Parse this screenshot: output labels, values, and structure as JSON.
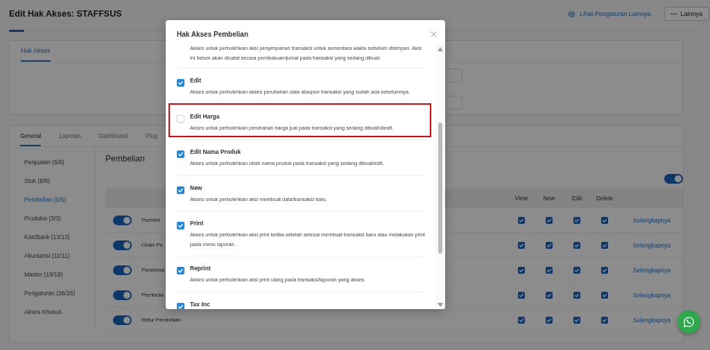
{
  "page": {
    "title": "Edit Hak Akses: STAFFSUS",
    "settings_link": "Lihat Pengaturan Lainnya",
    "more_button": "Lainnya"
  },
  "top_card": {
    "tabs": [
      {
        "label": "Hak Akses",
        "selected": true
      }
    ]
  },
  "section": {
    "tabs": [
      {
        "label": "General",
        "selected": true
      },
      {
        "label": "Laporan",
        "selected": false
      },
      {
        "label": "Dashboard",
        "selected": false
      },
      {
        "label": "Plug",
        "selected": false
      }
    ],
    "sidebar": [
      {
        "label": "Penjualan (6/6)",
        "selected": false
      },
      {
        "label": "Stok (8/8)",
        "selected": false
      },
      {
        "label": "Pembelian (5/5)",
        "selected": true
      },
      {
        "label": "Produksi (3/3)",
        "selected": false
      },
      {
        "label": "Kas/Bank (13/13)",
        "selected": false
      },
      {
        "label": "Akuntansi (11/11)",
        "selected": false
      },
      {
        "label": "Master (18/18)",
        "selected": false
      },
      {
        "label": "Pengaturan (26/26)",
        "selected": false
      },
      {
        "label": "Akses Khusus",
        "selected": false
      }
    ],
    "heading": "Pembelian",
    "all_on": true,
    "columns": [
      "View",
      "New",
      "Edit",
      "Delete"
    ],
    "rows": [
      {
        "name": "Permint",
        "on": true,
        "checks": [
          true,
          true,
          true,
          true
        ],
        "link": "Selengkapnya"
      },
      {
        "name": "Order Pe",
        "on": true,
        "checks": [
          true,
          true,
          true,
          true
        ],
        "link": "Selengkapnya"
      },
      {
        "name": "Penerima",
        "on": true,
        "checks": [
          true,
          true,
          true,
          true
        ],
        "link": "Selengkapnya"
      },
      {
        "name": "Pembelia",
        "on": true,
        "checks": [
          true,
          true,
          true,
          true
        ],
        "link": "Selengkapnya"
      },
      {
        "name": "Retur Pembelian",
        "on": true,
        "checks": [
          true,
          true,
          true,
          true
        ],
        "link": "Selengkapnya"
      }
    ]
  },
  "modal": {
    "title": "Hak Akses Pembelian",
    "cut_description": "Akses untuk perbolehkan aksi penyimpanan transaksi untuk sementara waktu sebelum disimpan. Aksi ini belum akan dicatat secara pembukuan/jurnal pada transaksi yang sedang dibuat.",
    "items": [
      {
        "label": "Edit",
        "checked": true,
        "highlighted": false,
        "description": "Akses untuk perbolehkan akses perubahan data ataupun transaksi yang sudah ada sebelumnya."
      },
      {
        "label": "Edit Harga",
        "checked": false,
        "highlighted": true,
        "description": "Akses untuk perbolehkan perubahan harga jual pada transaksi yang sedang dibuat/diedit."
      },
      {
        "label": "Edit Nama Produk",
        "checked": true,
        "highlighted": false,
        "description": "Akses untuk perbolehkan ubah nama produk pada transaksi yang sedang dibuat/edit."
      },
      {
        "label": "New",
        "checked": true,
        "highlighted": false,
        "description": "Akses untuk perbolehkan aksi membuat data/transaksi baru."
      },
      {
        "label": "Print",
        "checked": true,
        "highlighted": false,
        "description": "Akses untuk perbolehkan aksi print ketika setelah selesai membuat transaksi baru atau melakukan print pada menu laporan."
      },
      {
        "label": "Reprint",
        "checked": true,
        "highlighted": false,
        "description": "Akses untuk perbolehkan aksi print ulang pada transaksi/laporan yang akses."
      },
      {
        "label": "Tax Inc",
        "checked": true,
        "highlighted": false
      }
    ]
  }
}
